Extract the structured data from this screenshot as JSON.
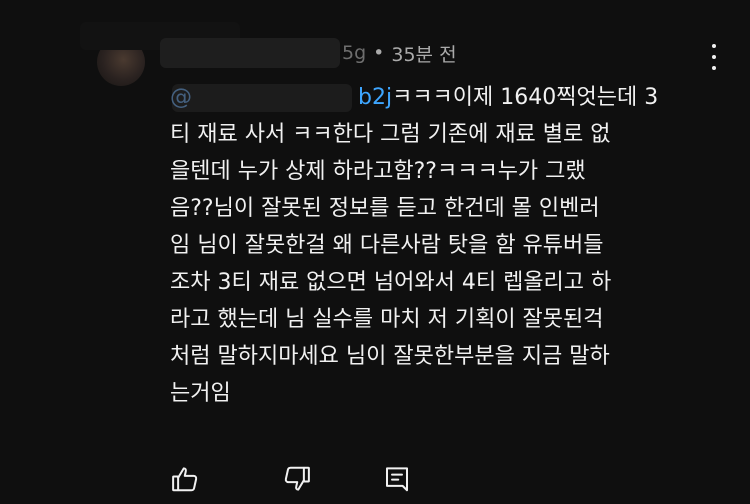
{
  "header": {
    "handle_tail": "5g",
    "separator": "•",
    "timestamp": "35분 전"
  },
  "comment": {
    "mention_lead": "@",
    "mention_tail": "b2j",
    "lines": [
      "ㅋㅋㅋ이제 1640찍엇는데 3",
      "티 재료 사서 ㅋㅋ한다 그럼 기존에 재료 별로 없",
      "을텐데 누가 상제 하라고함??ㅋㅋㅋ누가 그랬",
      "음??님이 잘못된 정보를 듣고 한건데 몰 인벤러",
      "임 님이 잘못한걸 왜 다른사람 탓을 함 유튜버들",
      "조차 3티 재료 없으면 넘어와서 4티 렙올리고 하",
      "라고 했는데 님 실수를 마치 저 기획이 잘못된걱",
      "처럼 말하지마세요 님이 잘못한부분을 지금 말하",
      "는거임"
    ]
  },
  "actions": {
    "like_icon": "thumbs-up-icon",
    "dislike_icon": "thumbs-down-icon",
    "reply_icon": "reply-comment-icon",
    "menu_icon": "more-vertical-icon"
  }
}
